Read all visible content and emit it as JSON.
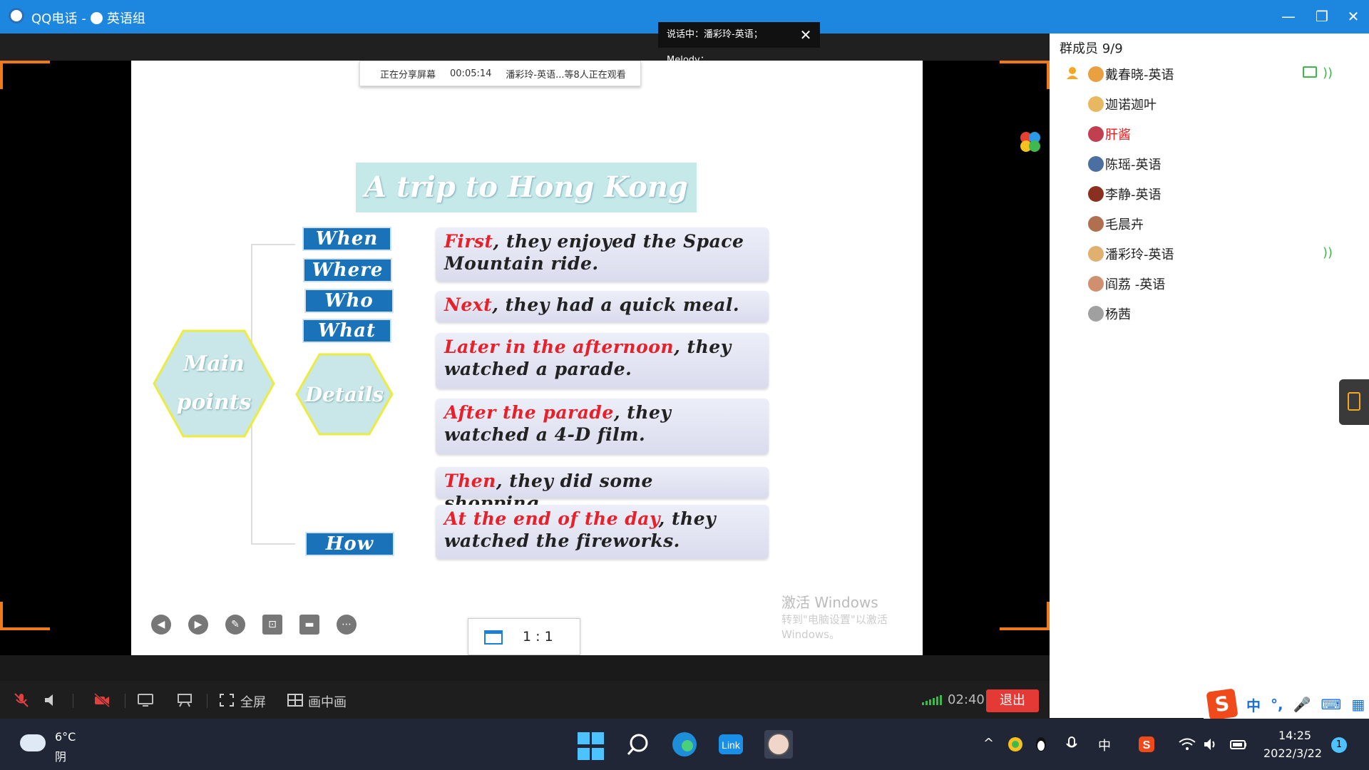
{
  "window": {
    "app_name": "QQ电话",
    "separator": "-",
    "group_name": "英语组",
    "minimize": "—",
    "restore": "❐",
    "close": "✕"
  },
  "share_banner": {
    "status": "正在分享屏幕",
    "elapsed": "00:05:14",
    "viewers": "潘彩玲-英语...等8人正在观看"
  },
  "speaker_tip": {
    "text": "说话中：潘彩玲-英语；Melody；",
    "close": "✕"
  },
  "slide": {
    "title": "A trip to Hong Kong",
    "main_points_line1": "Main",
    "main_points_line2": "points",
    "details": "Details",
    "tags": {
      "when": "When",
      "where": "Where",
      "who": "Who",
      "what": "What",
      "how": "How"
    },
    "cards": [
      {
        "highlight": "First",
        "rest": ", they enjoyed the Space Mountain ride."
      },
      {
        "highlight": "Next",
        "rest": ", they had a quick meal."
      },
      {
        "highlight": "Later in the afternoon",
        "rest": ", they watched a parade."
      },
      {
        "highlight": "After the parade",
        "rest": ", they watched a 4-D film."
      },
      {
        "highlight": "Then",
        "rest": ", they did some shopping."
      },
      {
        "highlight": "At the end of the day",
        "rest": ", they watched the fireworks."
      }
    ],
    "watermark_title": "激活 Windows",
    "watermark_sub": "转到\"电脑设置\"以激活 Windows。"
  },
  "view_ratio": "1 : 1",
  "panel": {
    "header": "群成员 9/9",
    "members": [
      {
        "name": "戴春晓-英语",
        "color": "#e8a040",
        "red": false
      },
      {
        "name": "迦诺迦叶",
        "color": "#e8b860",
        "red": false
      },
      {
        "name": "肝酱",
        "color": "#c04050",
        "red": true
      },
      {
        "name": "陈瑶-英语",
        "color": "#4a6fa0",
        "red": false
      },
      {
        "name": "李静-英语",
        "color": "#8a3020",
        "red": false
      },
      {
        "name": "毛晨卉",
        "color": "#b07050",
        "red": false
      },
      {
        "name": "潘彩玲-英语",
        "color": "#e0b070",
        "red": false
      },
      {
        "name": "阎荔 -英语",
        "color": "#d09070",
        "red": false
      },
      {
        "name": "杨茜",
        "color": "#a0a0a0",
        "red": false
      }
    ]
  },
  "ime": {
    "logo": "S",
    "lang": "中",
    "punct": "°,",
    "mic": "🎤",
    "kbd": "⌨",
    "grid": "▦"
  },
  "controls": {
    "fullscreen": "全屏",
    "pip": "画中画",
    "duration": "02:40",
    "exit": "退出"
  },
  "taskbar": {
    "temp": "6°C",
    "weather": "阴",
    "tray_chevron": "^",
    "ime_lang": "中",
    "time": "14:25",
    "date": "2022/3/22",
    "notifications": "1"
  }
}
